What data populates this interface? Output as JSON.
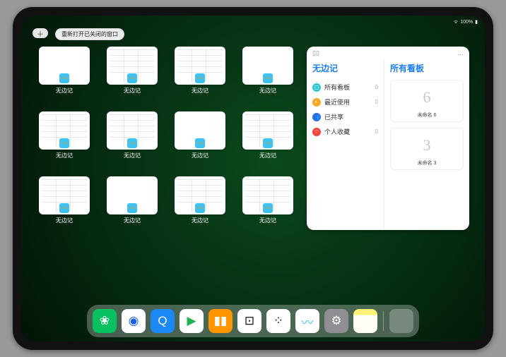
{
  "statusbar": {
    "battery": "100%"
  },
  "topbar": {
    "plus": "＋",
    "reopen": "重新打开已关闭的窗口"
  },
  "app_label": "无边记",
  "thumbs": [
    {
      "style": "blank"
    },
    {
      "style": "form"
    },
    {
      "style": "form"
    },
    {
      "style": "blank"
    },
    {
      "style": "form"
    },
    {
      "style": "form"
    },
    {
      "style": "blank"
    },
    {
      "style": "form"
    },
    {
      "style": "form"
    },
    {
      "style": "blank"
    },
    {
      "style": "form"
    },
    {
      "style": "form"
    }
  ],
  "panel": {
    "left_title": "无边记",
    "right_title": "所有看板",
    "ellipsis": "…",
    "menu": [
      {
        "icon": "▢",
        "color": "#2fc5d4",
        "label": "所有看板",
        "count": "0"
      },
      {
        "icon": "◐",
        "color": "#f7a824",
        "label": "最近使用",
        "count": "0"
      },
      {
        "icon": "👥",
        "color": "#2f6bf0",
        "label": "已共享",
        "count": ""
      },
      {
        "icon": "♡",
        "color": "#f2453d",
        "label": "个人收藏",
        "count": "0"
      }
    ],
    "boards": [
      {
        "glyph": "6",
        "title": "未命名 6",
        "sub": ""
      },
      {
        "glyph": "3",
        "title": "未命名 3",
        "sub": ""
      }
    ]
  },
  "dock": [
    {
      "name": "wechat-icon",
      "bg": "#07c160",
      "glyph": "❀"
    },
    {
      "name": "tencent-video-icon",
      "bg": "#fff",
      "glyph": "◉",
      "fg": "#1860f0"
    },
    {
      "name": "browser-icon",
      "bg": "#1a88f5",
      "glyph": "Q"
    },
    {
      "name": "play-store-icon",
      "bg": "#fff",
      "glyph": "▶",
      "fg": "#20b24c"
    },
    {
      "name": "books-icon",
      "bg": "#ff9500",
      "glyph": "▮▮",
      "fg": "#fff"
    },
    {
      "name": "dice-icon",
      "bg": "#fff",
      "glyph": "⊡",
      "fg": "#111"
    },
    {
      "name": "connect-icon",
      "bg": "#fff",
      "glyph": "⁘",
      "fg": "#111"
    },
    {
      "name": "freeform-icon",
      "bg": "#fff",
      "glyph": "〰",
      "fg": "#3dc3f2"
    },
    {
      "name": "settings-icon",
      "bg": "#8e8e93",
      "glyph": "⚙"
    },
    {
      "name": "notes-icon",
      "bg": "linear-gradient(#fff176 0 25%,#fffef5 25%)",
      "glyph": ""
    },
    {
      "name": "app-library-icon",
      "bg": "rgba(255,255,255,.25)",
      "glyph": "quad"
    }
  ]
}
